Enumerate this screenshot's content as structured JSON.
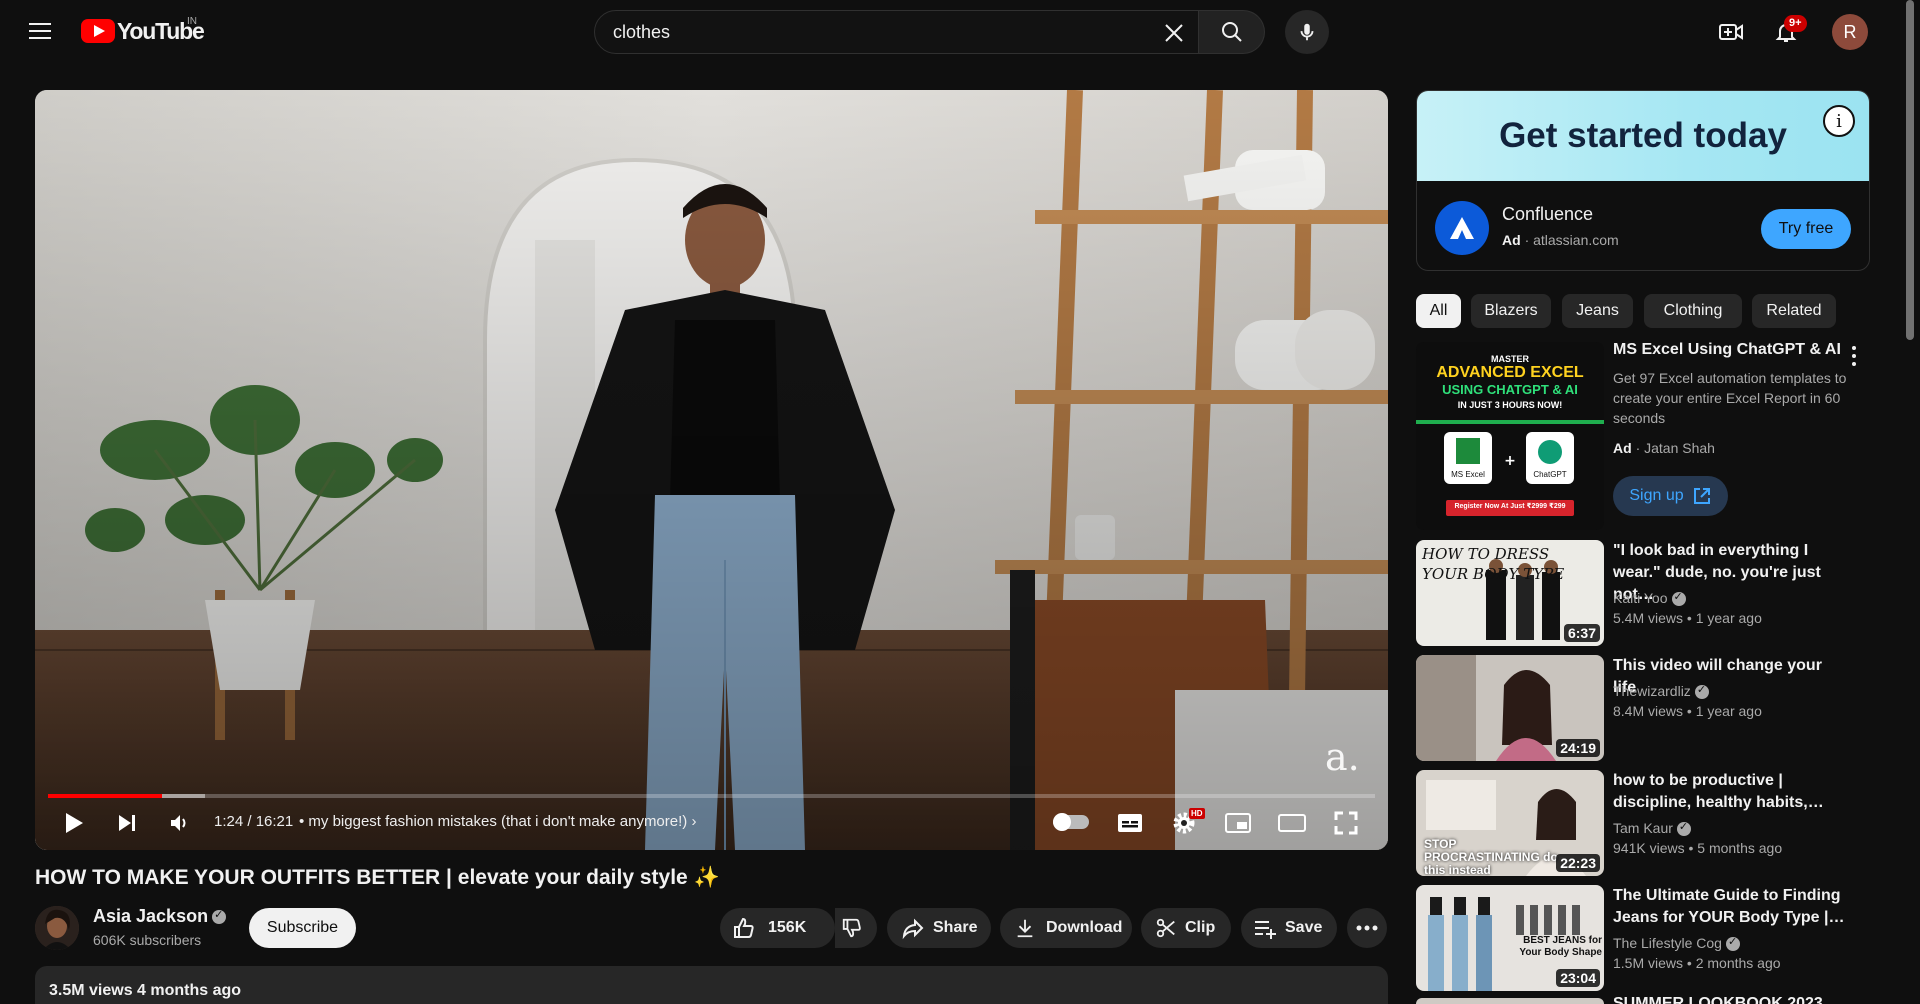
{
  "header": {
    "logo_text": "YouTube",
    "logo_country": "IN",
    "search_value": "clothes",
    "notification_count": "9+",
    "avatar_letter": "R"
  },
  "player": {
    "current_time": "1:24 / 16:21",
    "chapter": "• my biggest fashion mistakes (that i don't make anymore!)",
    "progress_fraction": 0.086,
    "buffer_fraction": 0.118,
    "hd_label": "HD",
    "watermark": "a."
  },
  "video": {
    "title": "HOW TO MAKE YOUR OUTFITS BETTER | elevate your daily style ✨",
    "channel_name": "Asia Jackson",
    "subscribers": "606K subscribers",
    "subscribe_label": "Subscribe",
    "likes": "156K",
    "share_label": "Share",
    "download_label": "Download",
    "clip_label": "Clip",
    "save_label": "Save",
    "views_date": "3.5M views  4 months ago"
  },
  "ad_card": {
    "banner_text": "Get started today",
    "advertiser": "Confluence",
    "ad_label": "Ad",
    "domain": "· atlassian.com",
    "cta": "Try free"
  },
  "chips": [
    "All",
    "Blazers",
    "Jeans",
    "Clothing",
    "Related"
  ],
  "ad_video": {
    "title": "MS Excel Using ChatGPT & AI",
    "description": "Get 97 Excel automation templates to create your entire Excel Report in 60 seconds",
    "ad_label": "Ad",
    "channel": "· Jatan Shah",
    "cta": "Sign up",
    "thumb_line1": "MASTER",
    "thumb_line2": "ADVANCED EXCEL",
    "thumb_line3": "USING CHATGPT & AI",
    "thumb_line4": "IN JUST 3 HOURS NOW!",
    "thumb_label_excel": "MS Excel",
    "thumb_label_gpt": "ChatGPT",
    "thumb_footer": "Register Now At Just ₹2999 ₹299"
  },
  "recommendations": [
    {
      "title": "\"I look bad in everything I wear.\" dude, no. you're just not…",
      "channel": "Kaiti Yoo",
      "stats": "5.4M views  • 1 year ago",
      "duration": "6:37",
      "thumb_text": "HOW TO DRESS YOUR BODY TYPE"
    },
    {
      "title": "This video will change your life",
      "channel": "Thewizardliz",
      "stats": "8.4M views  • 1 year ago",
      "duration": "24:19",
      "thumb_text": ""
    },
    {
      "title": "how to be productive | discipline, healthy habits,…",
      "channel": "Tam Kaur",
      "stats": "941K views  • 5 months ago",
      "duration": "22:23",
      "thumb_text": "STOP PROCRASTINATING do this instead"
    },
    {
      "title": "The Ultimate Guide to Finding Jeans for YOUR Body Type |…",
      "channel": "The Lifestyle Cog",
      "stats": "1.5M views  • 2 months ago",
      "duration": "23:04",
      "thumb_text": "BEST JEANS for Your Body Shape"
    }
  ],
  "next_partial_title": "SUMMER LOOKBOOK 2023"
}
